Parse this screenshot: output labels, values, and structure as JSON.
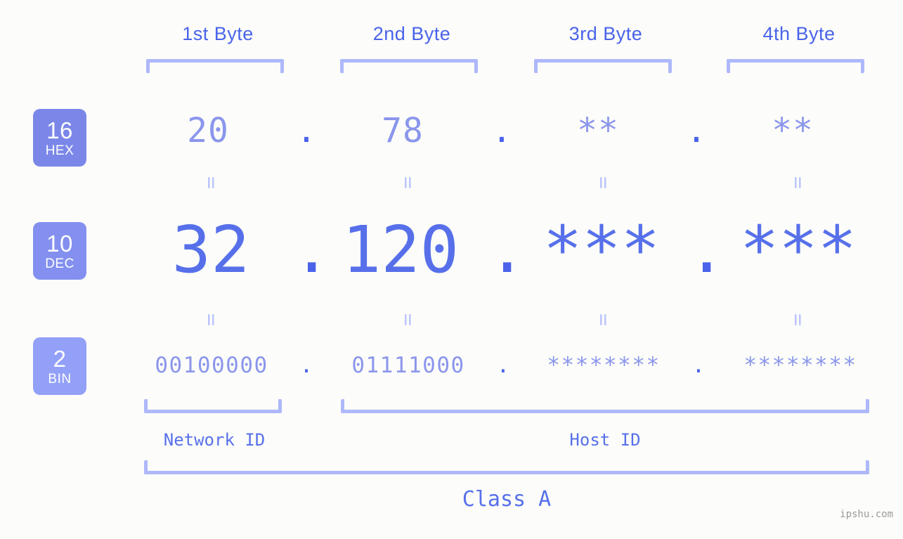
{
  "watermark": "ipshu.com",
  "background_color": "#fcfdfa",
  "accent_color": "#5770ea",
  "accent_light_color": "#8b96ec",
  "bracket_color": "#aeb8fb",
  "byte_headers": [
    {
      "label": "1st Byte"
    },
    {
      "label": "2nd Byte"
    },
    {
      "label": "3rd Byte"
    },
    {
      "label": "4th Byte"
    }
  ],
  "radix_badges": [
    {
      "number": "16",
      "name": "HEX",
      "color": "#7b87e8"
    },
    {
      "number": "10",
      "name": "DEC",
      "color": "#8390ef"
    },
    {
      "number": "2",
      "name": "BIN",
      "color": "#93a0f7"
    }
  ],
  "rows": {
    "hex": {
      "radix": "16",
      "radix_name": "HEX",
      "values": [
        "20",
        "78",
        "**",
        "**"
      ],
      "separator": "."
    },
    "dec": {
      "radix": "10",
      "radix_name": "DEC",
      "values": [
        "32",
        "120",
        "***",
        "***"
      ],
      "separator": "."
    },
    "bin": {
      "radix": "2",
      "radix_name": "BIN",
      "values": [
        "00100000",
        "01111000",
        "********",
        "********"
      ],
      "separator": "."
    }
  },
  "equals_symbol": "=",
  "sections": {
    "network_id": "Network ID",
    "host_id": "Host ID",
    "class": "Class A"
  }
}
